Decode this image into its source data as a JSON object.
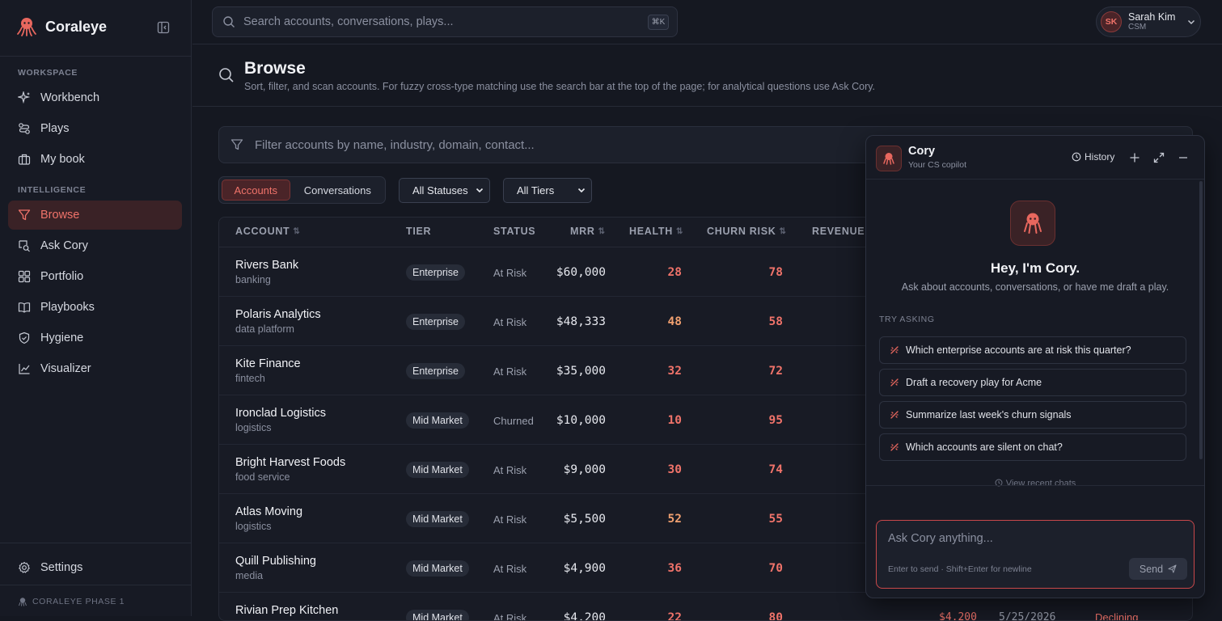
{
  "app": {
    "name": "Coraleye"
  },
  "sidebar": {
    "sections": [
      "WORKSPACE",
      "INTELLIGENCE"
    ],
    "items": [
      {
        "label": "Workbench",
        "icon": "sparkles-icon"
      },
      {
        "label": "Plays",
        "icon": "route-icon"
      },
      {
        "label": "My book",
        "icon": "briefcase-icon"
      },
      {
        "label": "Browse",
        "icon": "filter-icon",
        "active": true
      },
      {
        "label": "Ask Cory",
        "icon": "chat-search-icon"
      },
      {
        "label": "Portfolio",
        "icon": "grid-icon"
      },
      {
        "label": "Playbooks",
        "icon": "book-icon"
      },
      {
        "label": "Hygiene",
        "icon": "shield-icon"
      },
      {
        "label": "Visualizer",
        "icon": "chart-icon"
      }
    ],
    "settings": "Settings",
    "footer": "CORALEYE PHASE 1"
  },
  "search": {
    "placeholder": "Search accounts, conversations, plays...",
    "shortcut": "⌘K"
  },
  "user": {
    "initials": "SK",
    "name": "Sarah Kim",
    "role": "CSM"
  },
  "page": {
    "title": "Browse",
    "subtitle": "Sort, filter, and scan accounts. For fuzzy cross-type matching use the search bar at the top of the page; for analytical questions use Ask Cory."
  },
  "filter": {
    "placeholder": "Filter accounts by name, industry, domain, contact..."
  },
  "tabs": [
    "Accounts",
    "Conversations"
  ],
  "selects": {
    "status": "All Statuses",
    "tier": "All Tiers"
  },
  "table": {
    "columns": [
      "ACCOUNT",
      "TIER",
      "STATUS",
      "MRR",
      "HEALTH",
      "CHURN RISK",
      "REVENUE A"
    ],
    "rows": [
      {
        "name": "Rivers Bank",
        "industry": "banking",
        "tier": "Enterprise",
        "status": "At Risk",
        "mrr": "$60,000",
        "health": "28",
        "churn": "78"
      },
      {
        "name": "Polaris Analytics",
        "industry": "data platform",
        "tier": "Enterprise",
        "status": "At Risk",
        "mrr": "$48,333",
        "health": "48",
        "churn": "58"
      },
      {
        "name": "Kite Finance",
        "industry": "fintech",
        "tier": "Enterprise",
        "status": "At Risk",
        "mrr": "$35,000",
        "health": "32",
        "churn": "72"
      },
      {
        "name": "Ironclad Logistics",
        "industry": "logistics",
        "tier": "Mid Market",
        "status": "Churned",
        "mrr": "$10,000",
        "health": "10",
        "churn": "95"
      },
      {
        "name": "Bright Harvest Foods",
        "industry": "food service",
        "tier": "Mid Market",
        "status": "At Risk",
        "mrr": "$9,000",
        "health": "30",
        "churn": "74"
      },
      {
        "name": "Atlas Moving",
        "industry": "logistics",
        "tier": "Mid Market",
        "status": "At Risk",
        "mrr": "$5,500",
        "health": "52",
        "churn": "55"
      },
      {
        "name": "Quill Publishing",
        "industry": "media",
        "tier": "Mid Market",
        "status": "At Risk",
        "mrr": "$4,900",
        "health": "36",
        "churn": "70"
      },
      {
        "name": "Rivian Prep Kitchen",
        "industry": "",
        "tier": "Mid Market",
        "status": "At Risk",
        "mrr": "$4,200",
        "health": "22",
        "churn": "80",
        "revenue": "$4,200",
        "date": "5/25/2026",
        "trend": "Declining"
      }
    ]
  },
  "colors": {
    "accent": "#f0736a",
    "health_low": "#f0736a",
    "health_mid": "#f0a070"
  },
  "chat": {
    "title": "Cory",
    "subtitle": "Your CS copilot",
    "history": "History",
    "greeting": "Hey, I'm Cory.",
    "greeting_sub": "Ask about accounts, conversations, or have me draft a play.",
    "try_label": "TRY ASKING",
    "suggestions": [
      "Which enterprise accounts are at risk this quarter?",
      "Draft a recovery play for Acme",
      "Summarize last week's churn signals",
      "Which accounts are silent on chat?"
    ],
    "recent": "View recent chats",
    "input_placeholder": "Ask Cory anything...",
    "hint": "Enter to send · Shift+Enter for newline",
    "send": "Send"
  }
}
